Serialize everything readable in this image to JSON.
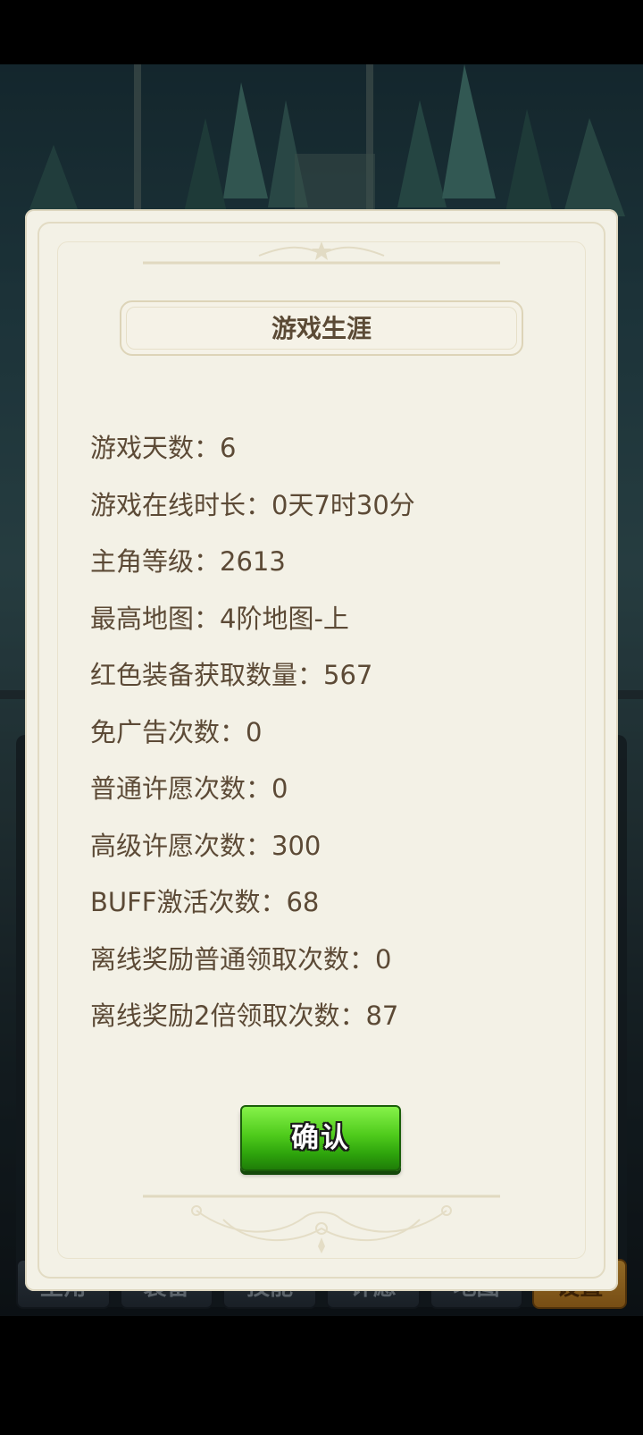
{
  "dialog": {
    "title": "游戏生涯",
    "stats": [
      "游戏天数：6",
      "游戏在线时长：0天7时30分",
      "主角等级：2613",
      "最高地图：4阶地图-上",
      "红色装备获取数量：567",
      "免广告次数：0",
      "普通许愿次数：0",
      "高级许愿次数：300",
      "BUFF激活次数：68",
      "离线奖励普通领取次数：0",
      "离线奖励2倍领取次数：87"
    ],
    "confirm_label": "确认"
  },
  "bottom_nav": {
    "tabs": [
      {
        "label": "主角",
        "active": false
      },
      {
        "label": "装备",
        "active": false
      },
      {
        "label": "技能",
        "active": false
      },
      {
        "label": "许愿",
        "active": false
      },
      {
        "label": "地图",
        "active": false
      },
      {
        "label": "设置",
        "active": true
      }
    ]
  },
  "colors": {
    "dialog_bg": "#f3f1e6",
    "text": "#5c4a36",
    "confirm_green": "#4fcb1c",
    "active_tab": "#e0a23a"
  }
}
